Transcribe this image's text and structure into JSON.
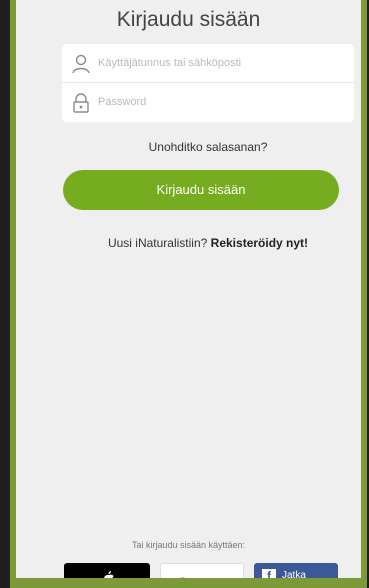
{
  "header": {
    "title": "Kirjaudu sisään"
  },
  "form": {
    "username_placeholder": "Käyttäjätunnus tai sähköposti",
    "password_placeholder": "Password",
    "forgot_password": "Unohditko salasanan?",
    "signin_button": "Kirjaudu sisään"
  },
  "signup": {
    "prompt": "Uusi iNaturalistiin?",
    "link": "Rekisteröidy nyt!"
  },
  "social": {
    "prompt": "Tai kirjaudu sisään käyttäen:",
    "facebook_label": "Jatka"
  },
  "colors": {
    "accent": "#76ac1f",
    "frame": "#7c9a3a",
    "panel": "#efefef",
    "facebook": "#3b5998"
  }
}
